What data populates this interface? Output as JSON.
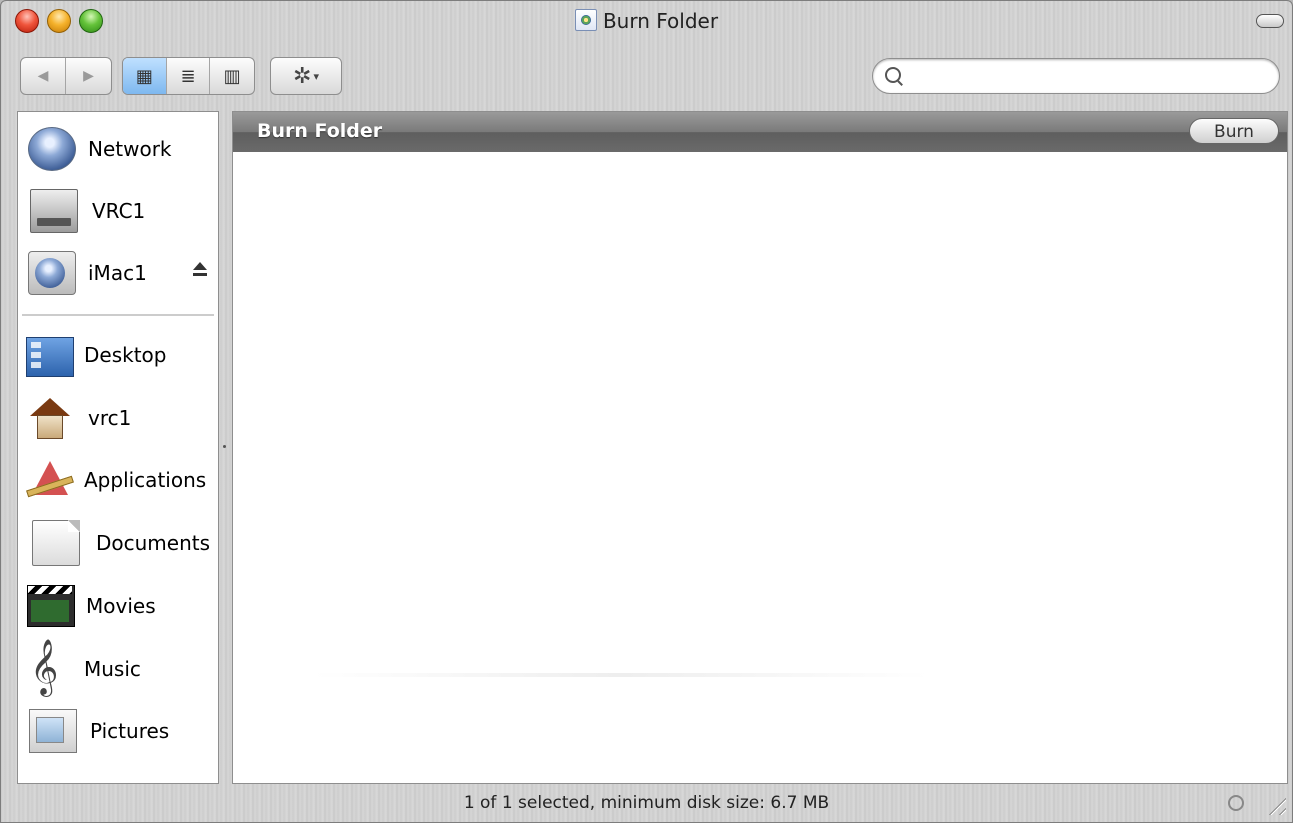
{
  "window": {
    "title": "Burn Folder"
  },
  "toolbar": {
    "back_label": "◀",
    "forward_label": "▶",
    "view_icon_label": "▦",
    "view_list_label": "≣",
    "view_column_label": "▥",
    "action_label": "✲",
    "action_caret": "▾",
    "search_value": "",
    "search_placeholder": ""
  },
  "sidebar": {
    "devices": [
      {
        "label": "Network",
        "icon": "network-globe-icon"
      },
      {
        "label": "VRC1",
        "icon": "hard-drive-icon"
      },
      {
        "label": "iMac1",
        "icon": "imac-icon"
      }
    ],
    "places": [
      {
        "label": "Desktop",
        "icon": "desktop-icon"
      },
      {
        "label": "vrc1",
        "icon": "home-icon"
      },
      {
        "label": "Applications",
        "icon": "applications-icon"
      },
      {
        "label": "Documents",
        "icon": "documents-icon"
      },
      {
        "label": "Movies",
        "icon": "movies-icon"
      },
      {
        "label": "Music",
        "icon": "music-icon"
      },
      {
        "label": "Pictures",
        "icon": "pictures-icon"
      }
    ]
  },
  "main": {
    "header_title": "Burn Folder",
    "burn_button": "Burn"
  },
  "status": {
    "text": "1 of 1 selected, minimum disk size: 6.7 MB"
  },
  "colors": {
    "selected_view": "#7eb8ef",
    "header_bar": "#6a6a6a"
  }
}
